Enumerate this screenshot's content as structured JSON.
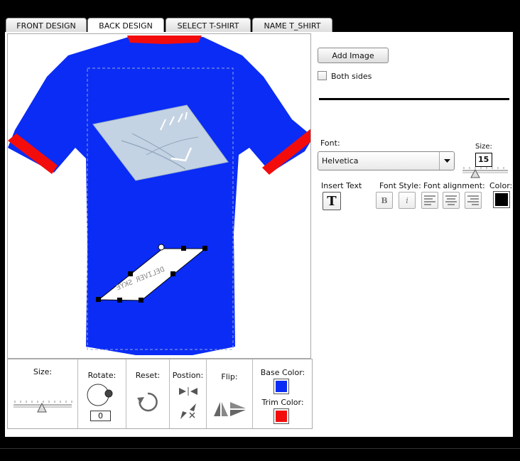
{
  "tabs": [
    {
      "label": "FRONT DESIGN"
    },
    {
      "label": "BACK DESIGN"
    },
    {
      "label": "SELECT T-SHIRT"
    },
    {
      "label": "NAME T_SHIRT"
    }
  ],
  "active_tab": "BACK DESIGN",
  "right_panel": {
    "add_image_label": "Add Image",
    "both_sides_label": "Both sides",
    "both_sides_checked": false,
    "font_label": "Font:",
    "font_value": "Helvetica",
    "size_label": "Size:",
    "size_value": "15",
    "insert_text_label": "Insert Text",
    "font_style_label": "Font Style:",
    "font_alignment_label": "Font alignment:",
    "color_label": "Color:",
    "text_color": "#000000"
  },
  "bottom_panel": {
    "size_label": "Size:",
    "rotate_label": "Rotate:",
    "rotate_value": "0",
    "reset_label": "Reset:",
    "position_label": "Postion:",
    "flip_label": "Flip:",
    "base_color_label": "Base Color:",
    "trim_color_label": "Trim Color:",
    "base_color": "#0a2cf5",
    "trim_color": "#f30c0c"
  },
  "shirt": {
    "base_color": "#0a2cf5",
    "trim_color": "#f30c0c"
  }
}
